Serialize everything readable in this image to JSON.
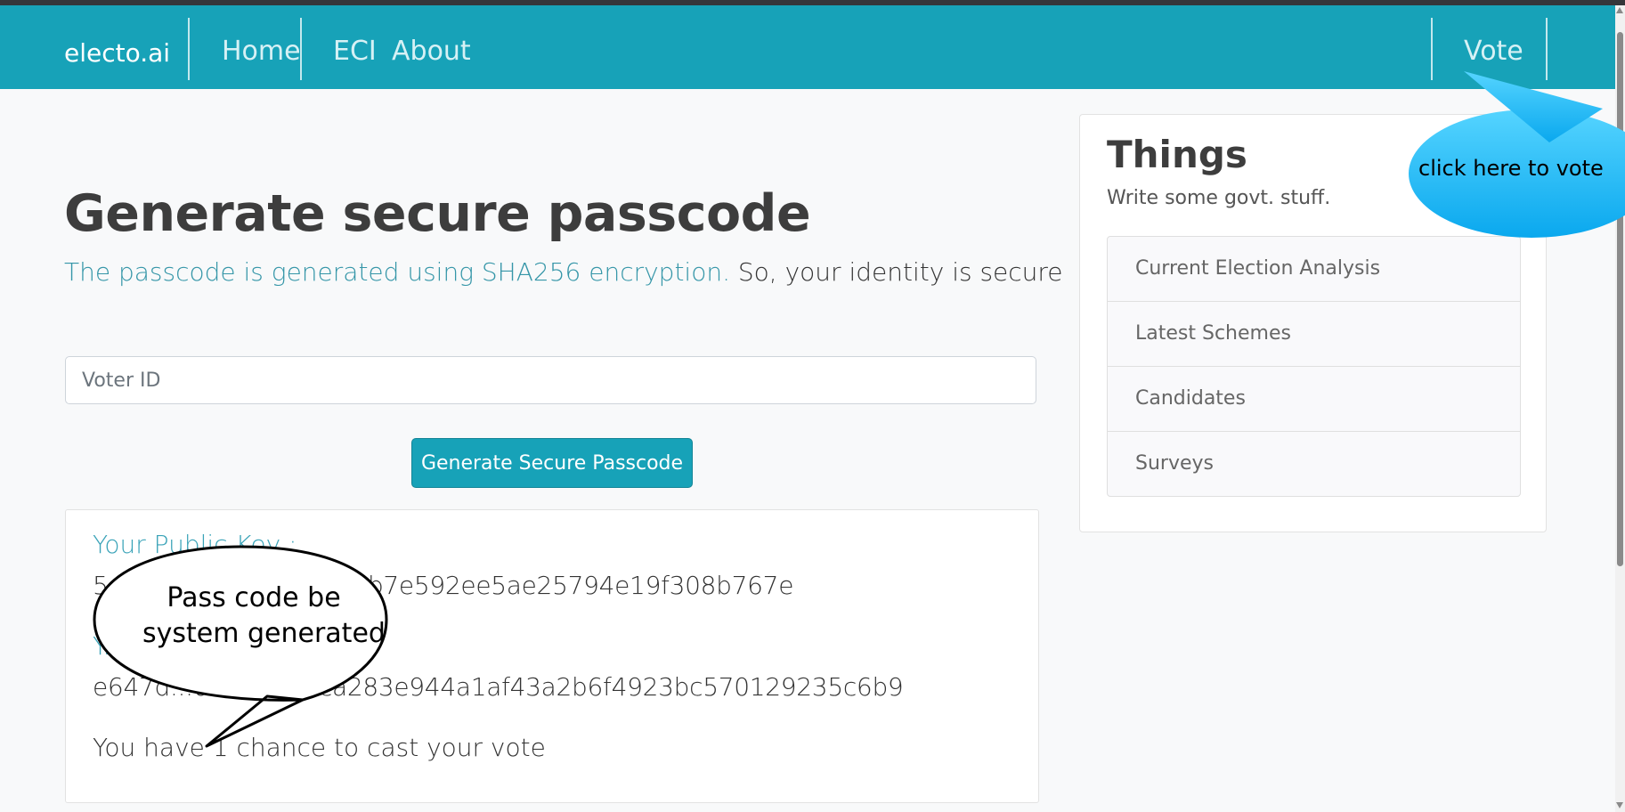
{
  "navbar": {
    "brand": "electo.ai",
    "links": [
      "Home",
      "ECI",
      "About"
    ],
    "right_link": "Vote",
    "color": "#17a2b8"
  },
  "main": {
    "heading": "Generate secure passcode",
    "lead_accent": "The passcode is generated using SHA256 encryption.",
    "lead_rest": "So, your identity is secure",
    "voter_id_placeholder": "Voter ID",
    "generate_button": "Generate Secure Passcode",
    "public_key_label": "Your Public Key :",
    "public_key_value": "5e...d6247c1e7e0c9f1b7e592ee5ae25794e19f308b767e",
    "private_key_label": "Y...",
    "private_key_value": "e647d...0e6f3f835ca283e944a1af43a2b6f4923bc570129235c6b9",
    "chances_text": "You have 1 chance to cast your vote"
  },
  "sidebar": {
    "title": "Things",
    "subtitle": "Write some govt. stuff.",
    "items": [
      "Current Election Analysis",
      "Latest Schemes",
      "Candidates",
      "Surveys"
    ]
  },
  "annotations": {
    "passcode_bubble_line1": "Pass code be",
    "passcode_bubble_line2": "system generated",
    "vote_bubble": "click here to vote"
  }
}
